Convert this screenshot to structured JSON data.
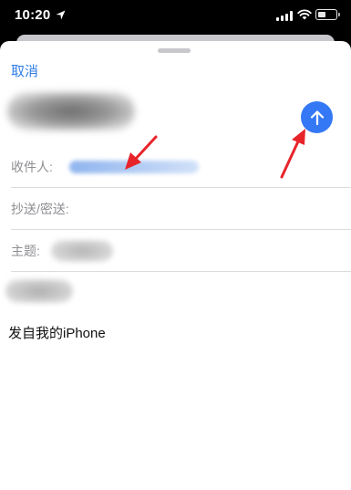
{
  "status_bar": {
    "time": "10:20",
    "icons": [
      "location-arrow-icon",
      "signal-bars-icon",
      "wifi-icon",
      "battery-icon"
    ]
  },
  "compose": {
    "cancel_label": "取消",
    "send_icon": "arrow-up-icon",
    "accent_color": "#3478f6",
    "fields": {
      "to_label": "收件人:",
      "cc_bcc_label": "抄送/密送:",
      "subject_label": "主题:"
    },
    "signature": "发自我的iPhone"
  },
  "annotations": {
    "arrow_color": "#e8242b",
    "items": [
      "annotation-arrow-to-recipient",
      "annotation-arrow-to-send-button"
    ]
  }
}
